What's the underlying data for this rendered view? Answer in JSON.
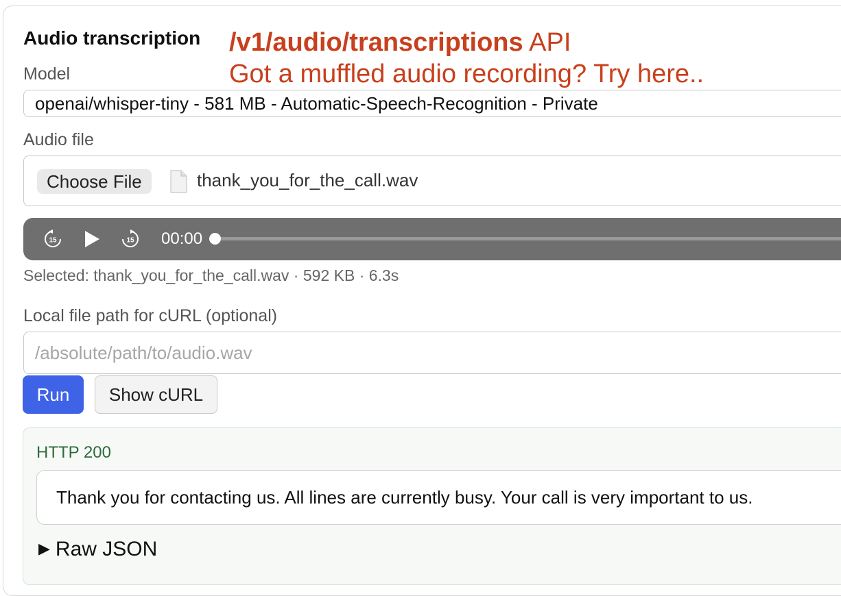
{
  "panel": {
    "title": "Audio transcription"
  },
  "annotation": {
    "endpoint": "/v1/audio/transcriptions",
    "api_word": "API",
    "tagline": "Got a muffled audio recording? Try here.."
  },
  "model": {
    "label": "Model",
    "selected": "openai/whisper-tiny - 581 MB - Automatic-Speech-Recognition - Private"
  },
  "audio_file": {
    "label": "Audio file",
    "choose_button": "Choose File",
    "file_name": "thank_you_for_the_call.wav",
    "file_icon": "document-icon"
  },
  "player": {
    "rewind_icon": "rewind-15-icon",
    "play_icon": "play-icon",
    "forward_icon": "forward-15-icon",
    "skip_seconds": "15",
    "current_time": "00:00",
    "progress": 0
  },
  "selected_info": "Selected: thank_you_for_the_call.wav · 592 KB · 6.3s",
  "curl_path": {
    "label": "Local file path for cURL (optional)",
    "value": "",
    "placeholder": "/absolute/path/to/audio.wav"
  },
  "actions": {
    "run": "Run",
    "show_curl": "Show cURL"
  },
  "result": {
    "status": "HTTP 200",
    "transcript": "Thank you for contacting us. All lines are currently busy. Your call is very important to us.",
    "raw_toggle": "Raw JSON",
    "raw_icon": "disclosure-triangle-icon"
  },
  "colors": {
    "accent": "#3f63e6",
    "annotation": "#c8401d",
    "status_ok": "#2f6a3c",
    "player_bg": "#6f6f6f"
  }
}
